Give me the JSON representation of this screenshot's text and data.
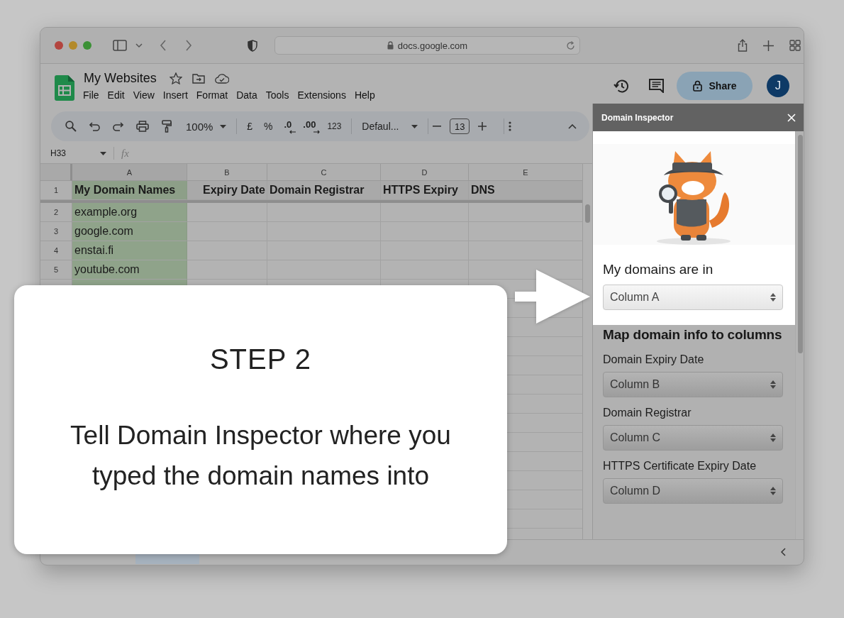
{
  "browser": {
    "url": "docs.google.com"
  },
  "document": {
    "title": "My Websites",
    "menus": [
      "File",
      "Edit",
      "View",
      "Insert",
      "Format",
      "Data",
      "Tools",
      "Extensions",
      "Help"
    ],
    "share_label": "Share",
    "avatar": "J"
  },
  "toolbar": {
    "zoom": "100%",
    "currency": "£",
    "percent": "%",
    "decrease_decimals": ".0",
    "increase_decimals": ".00",
    "number_format": "123",
    "font": "Defaul...",
    "font_size": "13"
  },
  "formula_bar": {
    "cell": "H33",
    "fx": "fx"
  },
  "sheet": {
    "columns": [
      {
        "label": "A",
        "selected": true
      },
      {
        "label": "B",
        "selected": false
      },
      {
        "label": "C",
        "selected": false
      },
      {
        "label": "D",
        "selected": false
      },
      {
        "label": "E",
        "selected": false
      }
    ],
    "rows": [
      {
        "number": "1",
        "cells": [
          "My Domain Names",
          "Expiry Date",
          "Domain Registrar",
          "HTTPS Expiry",
          "DNS"
        ]
      },
      {
        "number": "2",
        "cells": [
          "example.org",
          "",
          "",
          "",
          ""
        ]
      },
      {
        "number": "3",
        "cells": [
          "google.com",
          "",
          "",
          "",
          ""
        ]
      },
      {
        "number": "4",
        "cells": [
          "enstai.fi",
          "",
          "",
          "",
          ""
        ]
      },
      {
        "number": "5",
        "cells": [
          "youtube.com",
          "",
          "",
          "",
          ""
        ]
      }
    ]
  },
  "panel": {
    "title": "Domain Inspector",
    "domains_label": "My domains are in",
    "domains_value": "Column A",
    "mapping_heading": "Map domain info to columns",
    "mappings": [
      {
        "label": "Domain Expiry Date",
        "value": "Column B"
      },
      {
        "label": "Domain Registrar",
        "value": "Column C"
      },
      {
        "label": "HTTPS Certificate Expiry Date",
        "value": "Column D"
      }
    ]
  },
  "callout": {
    "step": "STEP 2",
    "text": "Tell Domain Inspector where you typed the domain names into"
  }
}
